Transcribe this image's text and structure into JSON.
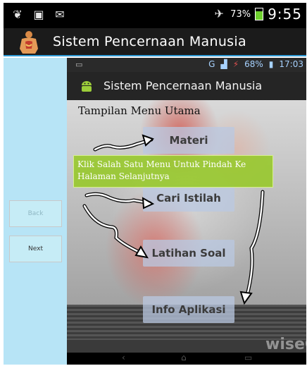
{
  "status_bar": {
    "battery_percent": "73%",
    "time": "9:55",
    "icons": [
      "sound-icon",
      "image-icon",
      "message-icon",
      "airplane-icon",
      "battery-icon"
    ]
  },
  "action_bar": {
    "title": "Sistem Pencernaan Manusia",
    "logo": "body-anatomy-icon"
  },
  "nav": {
    "back_label": "Back",
    "next_label": "Next"
  },
  "embedded": {
    "status": {
      "network": "G",
      "battery": "68%",
      "time": "17:03"
    },
    "app_title": "Sistem Pencernaan Manusia",
    "heading": "Tampilan Menu Utama",
    "menu": [
      {
        "label": "Materi"
      },
      {
        "label": "Cari Istilah"
      },
      {
        "label": "Latihan Soal"
      },
      {
        "label": "Info Aplikasi"
      }
    ],
    "tooltip": "Klik Salah Satu Menu Untuk Pindah Ke Halaman Selanjutnya",
    "watermark": "wiseG"
  },
  "colors": {
    "accent": "#2f9bd6",
    "tooltip": "#96c828",
    "left_panel": "#b7e4f6"
  }
}
